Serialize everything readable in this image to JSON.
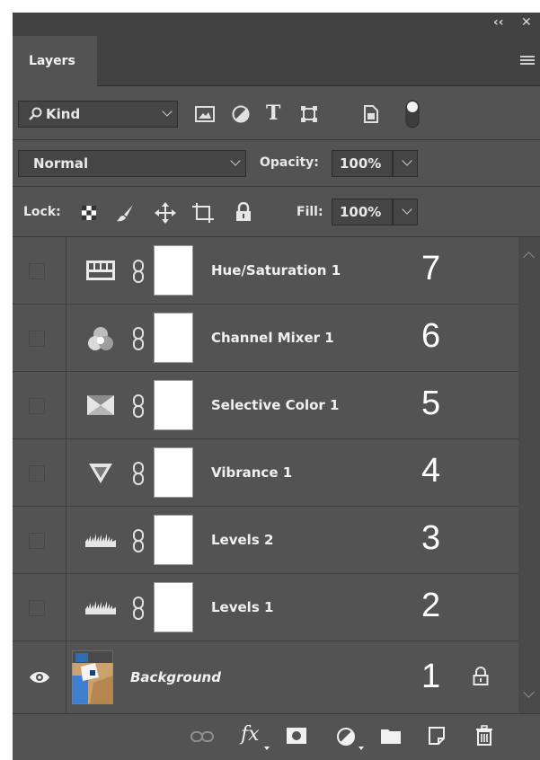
{
  "panel": {
    "title": "Layers",
    "collapse_icon": "double-chevron-left-icon",
    "close_icon": "close-icon",
    "menu_icon": "panel-menu-icon"
  },
  "filter": {
    "kind_label": "Kind",
    "icons": [
      "pixel-filter-icon",
      "adjustment-filter-icon",
      "type-filter-icon",
      "shape-filter-icon",
      "smart-object-filter-icon",
      "filter-toggle-icon"
    ]
  },
  "blend": {
    "mode": "Normal",
    "opacity_label": "Opacity:",
    "opacity_value": "100%"
  },
  "lock": {
    "label": "Lock:",
    "icons": [
      "lock-transparent-icon",
      "lock-image-icon",
      "lock-position-icon",
      "lock-artboard-icon",
      "lock-all-icon"
    ],
    "fill_label": "Fill:",
    "fill_value": "100%"
  },
  "layers": [
    {
      "name": "Hue/Saturation 1",
      "number": "7",
      "icon": "hue-saturation-icon"
    },
    {
      "name": "Channel Mixer 1",
      "number": "6",
      "icon": "channel-mixer-icon"
    },
    {
      "name": "Selective Color 1",
      "number": "5",
      "icon": "selective-color-icon"
    },
    {
      "name": "Vibrance 1",
      "number": "4",
      "icon": "vibrance-icon"
    },
    {
      "name": "Levels 2",
      "number": "3",
      "icon": "levels-icon"
    },
    {
      "name": "Levels 1",
      "number": "2",
      "icon": "levels-icon"
    },
    {
      "name": "Background",
      "number": "1",
      "icon": "eye-icon"
    }
  ],
  "footer": {
    "icons": [
      "link-layers-icon",
      "fx-icon",
      "add-mask-icon",
      "new-adjustment-icon",
      "new-group-icon",
      "new-layer-icon",
      "trash-icon"
    ],
    "fx_text": "fx"
  }
}
